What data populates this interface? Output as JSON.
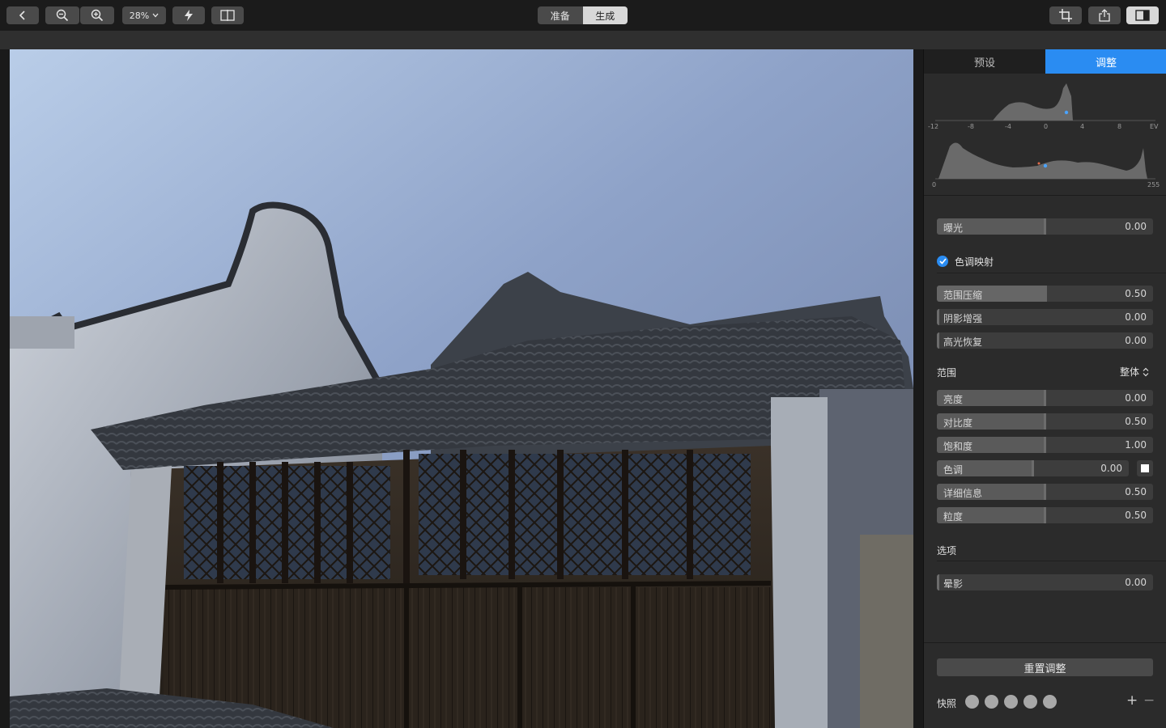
{
  "toolbar": {
    "zoom_value": "28%",
    "mode_prepare": "准备",
    "mode_generate": "生成"
  },
  "panel": {
    "tab_presets": "预设",
    "tab_adjust": "调整",
    "ev_ticks": [
      "-12",
      "-8",
      "-4",
      "0",
      "4",
      "8",
      "EV"
    ],
    "lum_ticks": [
      "0",
      "255"
    ],
    "exposure": {
      "label": "曝光",
      "value": "0.00"
    },
    "tonemap_title": "色调映射",
    "tonemap": [
      {
        "label": "范围压缩",
        "value": "0.50",
        "fill": 0.5
      },
      {
        "label": "阴影增强",
        "value": "0.00",
        "fill": 0.0
      },
      {
        "label": "高光恢复",
        "value": "0.00",
        "fill": 0.0
      }
    ],
    "range_title": "范围",
    "range_value": "整体",
    "range_sliders": [
      {
        "label": "亮度",
        "value": "0.00"
      },
      {
        "label": "对比度",
        "value": "0.50"
      },
      {
        "label": "饱和度",
        "value": "1.00"
      },
      {
        "label": "色调",
        "value": "0.00"
      },
      {
        "label": "详细信息",
        "value": "0.50"
      },
      {
        "label": "粒度",
        "value": "0.50"
      }
    ],
    "options_title": "选项",
    "vignette": {
      "label": "晕影",
      "value": "0.00"
    },
    "reset_label": "重置调整",
    "snapshot_label": "快照",
    "snapshot_add": "+",
    "snapshot_remove": "−"
  },
  "colors": {
    "accent": "#2a8cf2",
    "panel": "#2b2b2b",
    "slider": "#3d3d3d"
  }
}
